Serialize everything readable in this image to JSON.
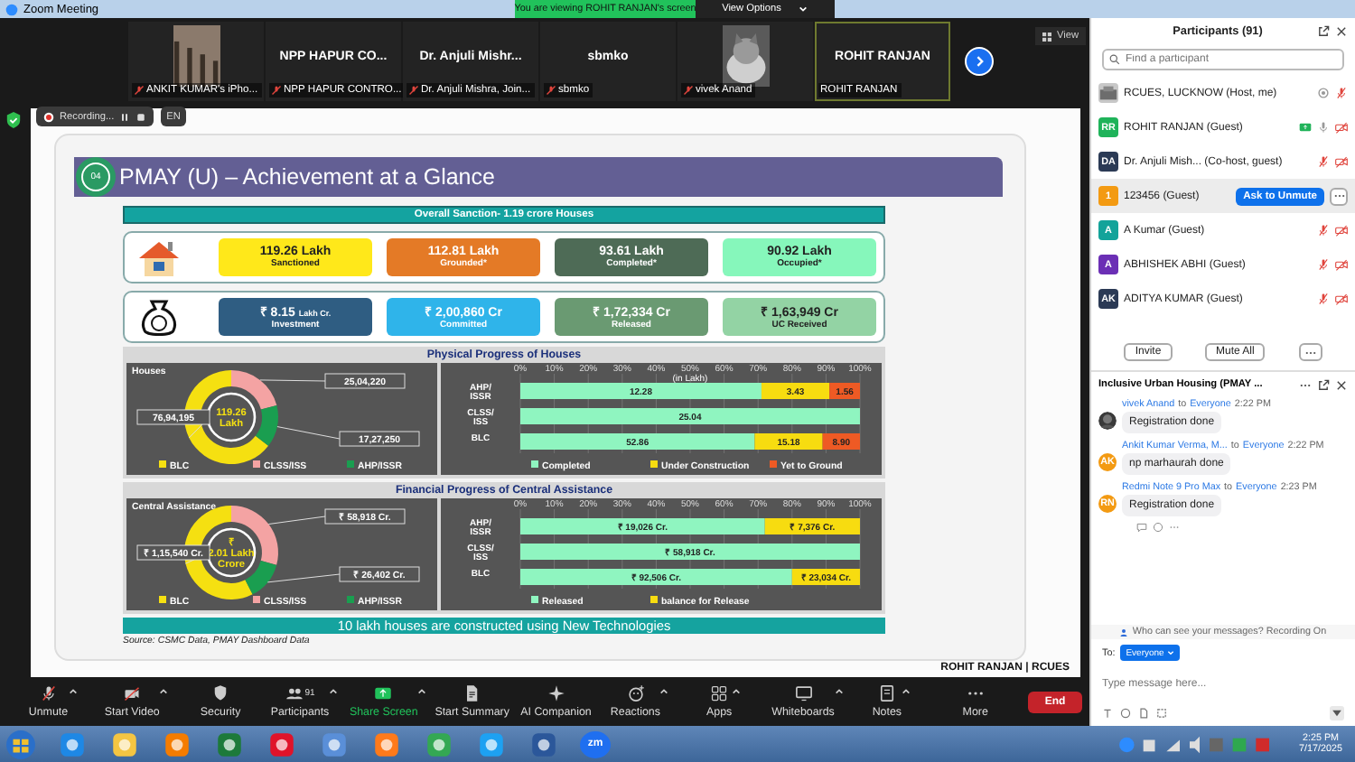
{
  "window": {
    "title": "Zoom Meeting"
  },
  "banner": {
    "text": "You are viewing ROHIT RANJAN's screen",
    "options": "View Options"
  },
  "video_strip": {
    "view_button": "View",
    "tiles": [
      {
        "kind": "picture",
        "label": "ANKIT KUMAR's iPho...",
        "muted": true,
        "active": false
      },
      {
        "kind": "name",
        "name": "NPP HAPUR CO...",
        "label": "NPP HAPUR CONTRO...",
        "muted": true,
        "active": false
      },
      {
        "kind": "name",
        "name": "Dr. Anjuli Mishr...",
        "label": "Dr. Anjuli Mishra, Join...",
        "muted": true,
        "active": false
      },
      {
        "kind": "name",
        "name": "sbmko",
        "label": "sbmko",
        "muted": true,
        "active": false
      },
      {
        "kind": "picture",
        "label": "vivek Anand",
        "muted": true,
        "active": false
      },
      {
        "kind": "name",
        "name": "ROHIT RANJAN",
        "label": "ROHIT RANJAN",
        "muted": false,
        "active": true
      }
    ]
  },
  "recording": {
    "label": "Recording...",
    "language": "EN"
  },
  "slide": {
    "number": "04",
    "title": "PMAY (U) – Achievement at a Glance",
    "overall": "Overall Sanction- 1.19 crore Houses",
    "tile_rows": [
      {
        "tiles": [
          {
            "value": "119.26 Lakh",
            "label": "Sanctioned",
            "color": "#ffe81a"
          },
          {
            "value": "112.81 Lakh",
            "label": "Grounded*",
            "color": "#e47a26"
          },
          {
            "value": "93.61 Lakh",
            "label": "Completed*",
            "color": "#4e6b56"
          },
          {
            "value": "90.92 Lakh",
            "label": "Occupied*",
            "color": "#86f7bb"
          }
        ]
      },
      {
        "tiles": [
          {
            "value": "₹ 8.15",
            "unit": "Lakh Cr.",
            "label": "Investment",
            "color": "#2f5d82"
          },
          {
            "value": "₹ 2,00,860 Cr",
            "label": "Committed",
            "color": "#2fb4ea"
          },
          {
            "value": "₹ 1,72,334 Cr",
            "label": "Released",
            "color": "#6a9a72"
          },
          {
            "value": "₹ 1,63,949 Cr",
            "label": "UC Received",
            "color": "#93d3a4"
          }
        ]
      }
    ],
    "sections": [
      {
        "title": "Physical Progress of Houses",
        "donut": {
          "chart_data": {
            "type": "donut",
            "title": "Houses",
            "categories": [
              "BLC",
              "CLSS/ISS",
              "AHP/ISSR"
            ],
            "series": [
              {
                "values": [
                  64.5,
                  21.0,
                  14.5
                ]
              }
            ],
            "colors": [
              "#f5e011",
              "#f4a3a3",
              "#1a9e50"
            ],
            "legend": "bottom",
            "value_labels": [
              "76,94,195",
              "25,04,220",
              "17,27,250"
            ],
            "annotations": [
              "119.26",
              "Lakh"
            ]
          }
        },
        "bars": {
          "chart_data": {
            "type": "bar",
            "orientation": "horizontal",
            "stacked": true,
            "title": "(in Lakh)",
            "categories": [
              "AHP/ ISSR",
              "CLSS/ ISS",
              "BLC"
            ],
            "legend": "bottom",
            "grid": true,
            "series": [
              {
                "name": "Completed",
                "color": "#8ff5c0",
                "values": [
                  71,
                  100,
                  69
                ]
              },
              {
                "name": "Under Construction",
                "color": "#f7dc10",
                "values": [
                  20,
                  null,
                  20
                ]
              },
              {
                "name": "Yet to Ground",
                "color": "#ee5a24",
                "values": [
                  9,
                  null,
                  11
                ]
              }
            ],
            "value_labels": [
              [
                "12.28",
                "25.04",
                "52.86"
              ],
              [
                "3.43",
                null,
                "15.18"
              ],
              [
                "1.56",
                null,
                "8.90"
              ]
            ],
            "xlim": [
              0,
              100
            ],
            "xticks": [
              {
                "value": 0,
                "label": "0%"
              },
              {
                "value": 10,
                "label": "10%"
              },
              {
                "value": 20,
                "label": "20%"
              },
              {
                "value": 30,
                "label": "30%"
              },
              {
                "value": 40,
                "label": "40%"
              },
              {
                "value": 50,
                "label": "50%"
              },
              {
                "value": 60,
                "label": "60%"
              },
              {
                "value": 70,
                "label": "70%"
              },
              {
                "value": 80,
                "label": "80%"
              },
              {
                "value": 90,
                "label": "90%"
              },
              {
                "value": 100,
                "label": "100%"
              }
            ]
          }
        }
      },
      {
        "title": "Financial Progress of Central Assistance",
        "donut": {
          "chart_data": {
            "type": "donut",
            "title": "Central Assistance",
            "categories": [
              "BLC",
              "CLSS/ISS",
              "AHP/ISSR"
            ],
            "series": [
              {
                "values": [
                  57.5,
                  29.3,
                  13.2
                ]
              }
            ],
            "colors": [
              "#f5e011",
              "#f4a3a3",
              "#1a9e50"
            ],
            "legend": "bottom",
            "value_labels": [
              "₹ 1,15,540 Cr.",
              "₹ 58,918 Cr.",
              "₹ 26,402 Cr."
            ],
            "annotations": [
              "₹",
              "2.01 Lakh",
              "Crore"
            ]
          }
        },
        "bars": {
          "chart_data": {
            "type": "bar",
            "orientation": "horizontal",
            "stacked": true,
            "categories": [
              "AHP/ ISSR",
              "CLSS/ ISS",
              "BLC"
            ],
            "legend": "bottom",
            "grid": true,
            "series": [
              {
                "name": "Released",
                "color": "#8ff5c0",
                "values": [
                  72,
                  100,
                  80
                ]
              },
              {
                "name": "balance for Release",
                "color": "#f7dc10",
                "values": [
                  28,
                  null,
                  20
                ]
              }
            ],
            "value_labels": [
              [
                "₹ 19,026 Cr.",
                "₹ 58,918 Cr.",
                "₹ 92,506 Cr."
              ],
              [
                "₹ 7,376 Cr.",
                null,
                "₹ 23,034 Cr."
              ]
            ],
            "xlim": [
              0,
              100
            ],
            "xticks": [
              {
                "value": 0,
                "label": "0%"
              },
              {
                "value": 10,
                "label": "10%"
              },
              {
                "value": 20,
                "label": "20%"
              },
              {
                "value": 30,
                "label": "30%"
              },
              {
                "value": 40,
                "label": "40%"
              },
              {
                "value": 50,
                "label": "50%"
              },
              {
                "value": 60,
                "label": "60%"
              },
              {
                "value": 70,
                "label": "70%"
              },
              {
                "value": 80,
                "label": "80%"
              },
              {
                "value": 90,
                "label": "90%"
              },
              {
                "value": 100,
                "label": "100%"
              }
            ]
          }
        }
      }
    ],
    "banner": "10 lakh houses are constructed using New Technologies",
    "source": "Source: CSMC Data, PMAY Dashboard Data",
    "presenter": "ROHIT RANJAN | RCUES"
  },
  "participants": {
    "title": "Participants (91)",
    "search": {
      "placeholder": "Find a participant"
    },
    "rows": [
      {
        "name": "RCUES, LUCKNOW (Host, me)",
        "recording": true,
        "muted": true,
        "video_off": false,
        "sharing": false,
        "selected": false
      },
      {
        "initials": "RR",
        "color": "#1fb35a",
        "name": "ROHIT RANJAN (Guest)",
        "recording": false,
        "muted": false,
        "video_off": true,
        "sharing": true,
        "selected": false
      },
      {
        "initials": "DA",
        "color": "#2b3a55",
        "name": "Dr. Anjuli Mish... (Co-host, guest)",
        "recording": false,
        "muted": true,
        "video_off": true,
        "sharing": false,
        "selected": false
      },
      {
        "initials": "1",
        "color": "#f39a12",
        "name": "123456 (Guest)",
        "action": "Ask to Unmute",
        "selected": true
      },
      {
        "initials": "A",
        "color": "#13a39a",
        "name": "A Kumar (Guest)",
        "recording": false,
        "muted": true,
        "video_off": true,
        "sharing": false,
        "selected": false
      },
      {
        "initials": "A",
        "color": "#6b2fb5",
        "name": "ABHISHEK ABHI (Guest)",
        "recording": false,
        "muted": true,
        "video_off": true,
        "sharing": false,
        "selected": false
      },
      {
        "initials": "AK",
        "color": "#2b3a55",
        "name": "ADITYA KUMAR (Guest)",
        "recording": false,
        "muted": true,
        "video_off": true,
        "sharing": false,
        "selected": false
      }
    ],
    "buttons": [
      "Invite",
      "Mute All"
    ]
  },
  "chat": {
    "title": "Inclusive Urban Housing (PMAY ...",
    "messages": [
      {
        "sender": "vivek Anand",
        "to": "to",
        "recipient": "Everyone",
        "time": "2:22 PM",
        "text": "Registration done"
      },
      {
        "initials": "AK",
        "color": "#f39a12",
        "sender": "Ankit Kumar Verma, M...",
        "to": "to",
        "recipient": "Everyone",
        "time": "2:22 PM",
        "text": "np marhaurah done"
      },
      {
        "initials": "RN",
        "color": "#f39a12",
        "sender": "Redmi Note 9 Pro Max",
        "to": "to",
        "recipient": "Everyone",
        "time": "2:23 PM",
        "text": "Registration done"
      }
    ],
    "notice": "Who can see your messages? Recording On",
    "to_label": "To:",
    "recipient": "Everyone",
    "placeholder": "Type message here..."
  },
  "toolbar": {
    "items": [
      {
        "label": "Unmute",
        "menu": true
      },
      {
        "label": "Start Video",
        "menu": true
      },
      {
        "label": "Security",
        "menu": false
      },
      {
        "label": "Participants",
        "count": "91",
        "menu": true
      },
      {
        "label": "Share Screen",
        "menu": true
      },
      {
        "label": "Start Summary",
        "menu": false
      },
      {
        "label": "AI Companion",
        "menu": false
      },
      {
        "label": "Reactions",
        "menu": true
      },
      {
        "label": "Apps",
        "menu": true
      },
      {
        "label": "Whiteboards",
        "menu": true
      },
      {
        "label": "Notes",
        "menu": true
      },
      {
        "label": "More",
        "menu": false
      }
    ],
    "end": "End"
  },
  "taskbar": {
    "zoom_label": "zm",
    "time": "2:25 PM",
    "date": "7/17/2025"
  }
}
